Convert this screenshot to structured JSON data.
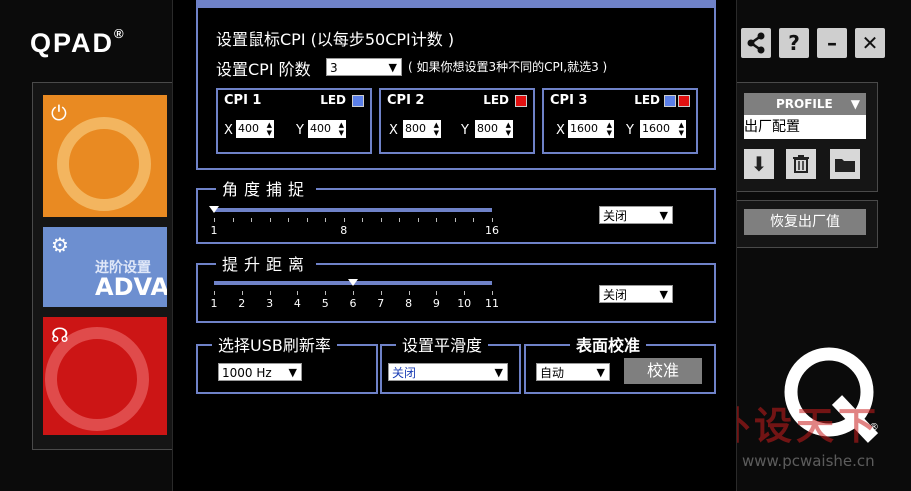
{
  "app": {
    "logo": "QPAD",
    "logo_mark": "®"
  },
  "window_buttons": [
    {
      "label": "<",
      "icon": "share-icon"
    },
    {
      "label": "?",
      "icon": "help-icon"
    },
    {
      "label": "–",
      "icon": "minimize-icon"
    },
    {
      "label": "✕",
      "icon": "close-icon"
    }
  ],
  "left_tiles": {
    "advanced_small": "进阶设置",
    "advanced_big": "ADVA"
  },
  "profile": {
    "header": "PROFILE",
    "value": "出厂配置"
  },
  "reset": {
    "label": "恢复出厂值"
  },
  "cpi": {
    "title_line": "设置鼠标CPI (以每步50CPI计数 )",
    "levels_label": "设置CPI 阶数",
    "levels_value": "3",
    "hint": "( 如果你想设置3种不同的CPI,就选3 )",
    "led_label": "LED",
    "x_label": "X",
    "y_label": "Y",
    "cards": [
      {
        "name": "CPI 1",
        "x": "400",
        "y": "400",
        "led_colors": [
          "#5b7fe8"
        ]
      },
      {
        "name": "CPI 2",
        "x": "800",
        "y": "800",
        "led_colors": [
          "#e01010"
        ]
      },
      {
        "name": "CPI 3",
        "x": "1600",
        "y": "1600",
        "led_colors": [
          "#5b7fe8",
          "#e01010"
        ]
      }
    ]
  },
  "angle": {
    "title": "角度捕捉",
    "labels": [
      "1",
      "8",
      "16"
    ],
    "min": 1,
    "max": 16,
    "value": 1,
    "select": "关闭"
  },
  "lift": {
    "title": "提升距离",
    "labels": [
      "1",
      "2",
      "3",
      "4",
      "5",
      "6",
      "7",
      "8",
      "9",
      "10",
      "11"
    ],
    "min": 1,
    "max": 11,
    "value": 6,
    "select": "关闭"
  },
  "usb": {
    "title": "选择USB刷新率",
    "select": "1000 Hz"
  },
  "smooth": {
    "title": "设置平滑度",
    "select": "关闭"
  },
  "surface": {
    "title": "表面校准",
    "select": "自动",
    "button": "校准"
  },
  "watermark": {
    "text": "外设天下",
    "url": "www.pcwaishe.cn"
  },
  "colors": {
    "accent": "#6f82c8",
    "orange": "#e98a22",
    "blue": "#6d8fd0",
    "red": "#cc1515"
  }
}
